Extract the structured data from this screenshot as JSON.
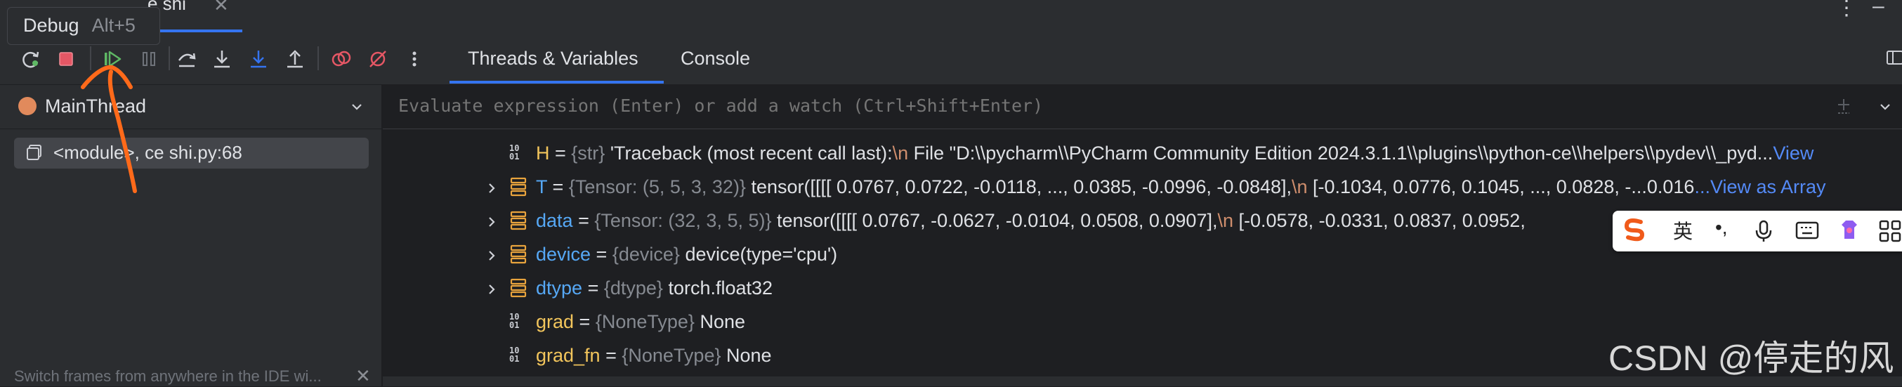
{
  "file_tab": {
    "label": "e shi"
  },
  "tooltip": {
    "title": "Debug",
    "shortcut": "Alt+5"
  },
  "tabs": [
    {
      "label": "Threads & Variables",
      "active": true
    },
    {
      "label": "Console",
      "active": false
    }
  ],
  "toolbar_icons": [
    "rerun-icon",
    "stop-icon",
    "resume-icon",
    "pause-icon",
    "step-over-icon",
    "step-into-icon",
    "step-into-my-code-icon",
    "step-out-icon",
    "view-breakpoints-icon",
    "mute-breakpoints-icon",
    "more-icon"
  ],
  "thread": {
    "name": "MainThread",
    "status_color": "#e18a5c"
  },
  "frames": [
    {
      "label": "<module>, ce shi.py:68"
    }
  ],
  "hint": "Switch frames from anywhere in the IDE wi...",
  "watch": {
    "placeholder": "Evaluate expression (Enter) or add a watch (Ctrl+Shift+Enter)"
  },
  "variables": [
    {
      "name": "H",
      "type": "{str}",
      "value": "'Traceback (most recent call last):\\n  File \"D:\\\\pycharm\\\\PyCharm Community Edition 2024.3.1.1\\\\plugins\\\\python-ce\\\\helpers\\\\pydev\\\\_pyd...",
      "link": "View",
      "expandable": false,
      "kind": "primitive"
    },
    {
      "name": "T",
      "type": "{Tensor: (5, 5, 3, 32)}",
      "value": "tensor([[[[ 0.0767,  0.0722, -0.0118,  ...,  0.0385, -0.0996, -0.0848],\\n          [-0.1034,  0.0776,  0.1045,  ...,  0.0828, -...0.016",
      "link": "...View as Array",
      "expandable": true,
      "kind": "object"
    },
    {
      "name": "data",
      "type": "{Tensor: (32, 3, 5, 5)}",
      "value": "tensor([[[[ 0.0767, -0.0627, -0.0104,  0.0508,  0.0907],\\n          [-0.0578, -0.0331,  0.0837,  0.0952,",
      "link": "",
      "expandable": true,
      "kind": "object"
    },
    {
      "name": "device",
      "type": "{device}",
      "value": "device(type='cpu')",
      "link": "",
      "expandable": true,
      "kind": "object"
    },
    {
      "name": "dtype",
      "type": "{dtype}",
      "value": "torch.float32",
      "link": "",
      "expandable": true,
      "kind": "object"
    },
    {
      "name": "grad",
      "type": "{NoneType}",
      "value": "None",
      "link": "",
      "expandable": false,
      "kind": "primitive"
    },
    {
      "name": "grad_fn",
      "type": "{NoneType}",
      "value": "None",
      "link": "",
      "expandable": false,
      "kind": "primitive"
    }
  ],
  "ime": {
    "language": "英",
    "punct": "•,"
  },
  "watermark": "CSDN @停走的风",
  "colors": {
    "accent": "#3574f0",
    "stop": "#e55765",
    "resume": "#5fb865",
    "annotation": "#ff6a1a"
  }
}
